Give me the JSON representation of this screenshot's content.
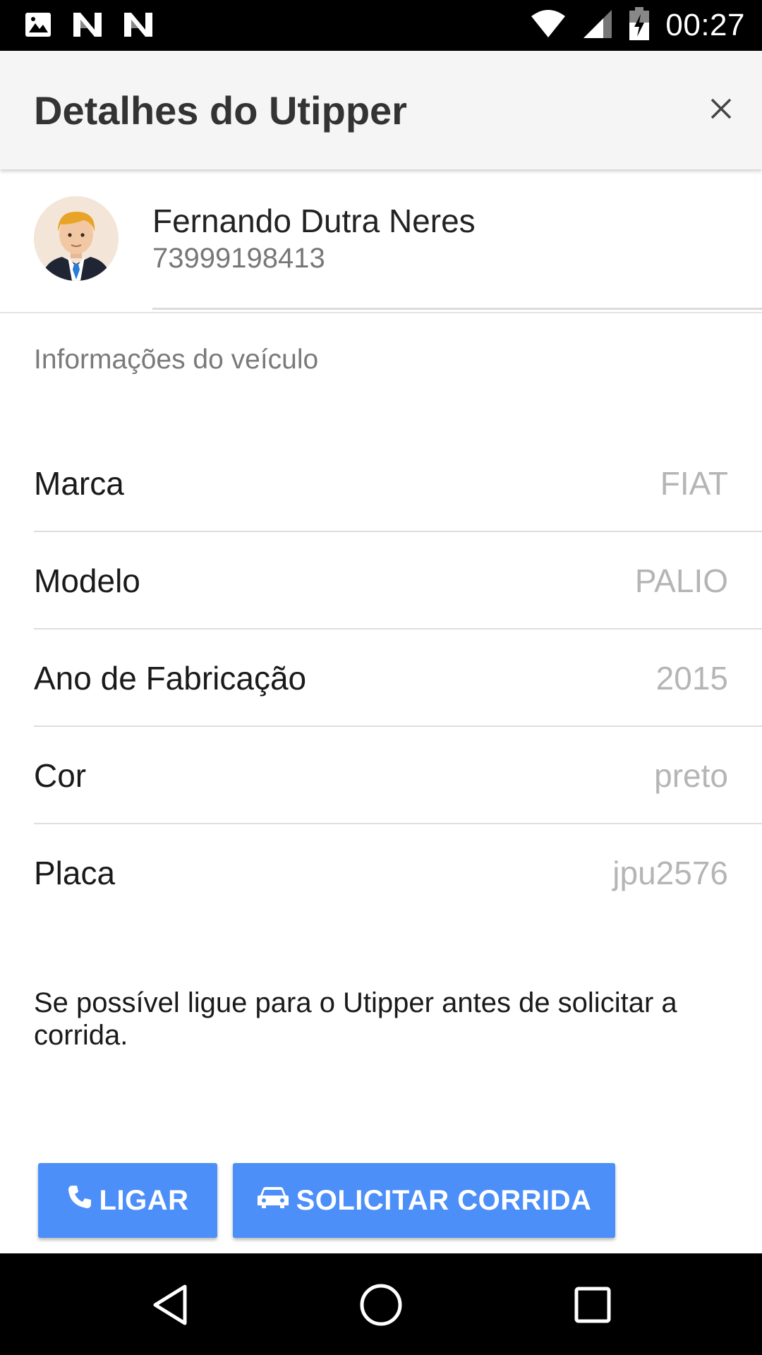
{
  "status_bar": {
    "time": "00:27",
    "icons": [
      "image-icon",
      "n-notification-icon",
      "n-notification-icon",
      "wifi-icon",
      "signal-icon",
      "battery-charging-icon"
    ]
  },
  "header": {
    "title": "Detalhes do Utipper",
    "close_icon": "close-icon"
  },
  "profile": {
    "name": "Fernando Dutra Neres",
    "phone": "73999198413",
    "avatar_icon": "avatar-icon"
  },
  "vehicle": {
    "section_title": "Informações do veículo",
    "rows": [
      {
        "label": "Marca",
        "value": "FIAT"
      },
      {
        "label": "Modelo",
        "value": "PALIO"
      },
      {
        "label": "Ano de Fabricação",
        "value": "2015"
      },
      {
        "label": "Cor",
        "value": "preto"
      },
      {
        "label": "Placa",
        "value": "jpu2576"
      }
    ]
  },
  "notice": "Se possível ligue para o Utipper antes de solicitar a corrida.",
  "actions": {
    "call_label": "LIGAR",
    "call_icon": "phone-icon",
    "ride_label": "SOLICITAR CORRIDA",
    "ride_icon": "car-icon"
  },
  "nav_bar": {
    "icons": [
      "back-icon",
      "home-icon",
      "recents-icon"
    ]
  },
  "colors": {
    "accent": "#4d8ff9",
    "header_bg": "#f5f5f5",
    "value_text": "#b5b5b5"
  }
}
